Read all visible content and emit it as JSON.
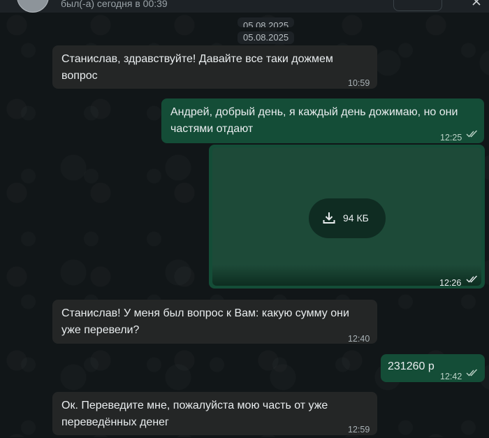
{
  "header": {
    "status": "был(-а) сегодня в 00:39"
  },
  "dates": [
    "05.08.2025",
    "05.08.2025"
  ],
  "messages": [
    {
      "text_line1": "Станислав, здравствуйте! Давайте все таки дожмем",
      "text_line2": "вопрос",
      "time": "10:59",
      "direction": "in"
    },
    {
      "text_line1": "Андрей, добрый день, я каждый день дожимаю, но они",
      "text_line2": "частями отдают",
      "time": "12:25",
      "direction": "out",
      "read": true
    },
    {
      "file_size": "94 КБ",
      "time": "12:26",
      "direction": "out",
      "read": true,
      "type": "file"
    },
    {
      "text_line1": "Станислав! У меня был вопрос к Вам: какую сумму они",
      "text_line2": "уже перевели?",
      "time": "12:40",
      "direction": "in"
    },
    {
      "text_line1": "231260 р",
      "time": "12:42",
      "direction": "out",
      "read": true
    },
    {
      "text_line1": "Ок. Переведите мне, пожалуйста мою часть от уже",
      "text_line2": "переведённых денег",
      "time": "12:59",
      "direction": "in"
    }
  ],
  "colors": {
    "incoming": "#242626",
    "outgoing": "#144d37",
    "background": "#111618"
  },
  "icons": {
    "download": "download-icon",
    "read_receipt": "double-check-icon"
  }
}
